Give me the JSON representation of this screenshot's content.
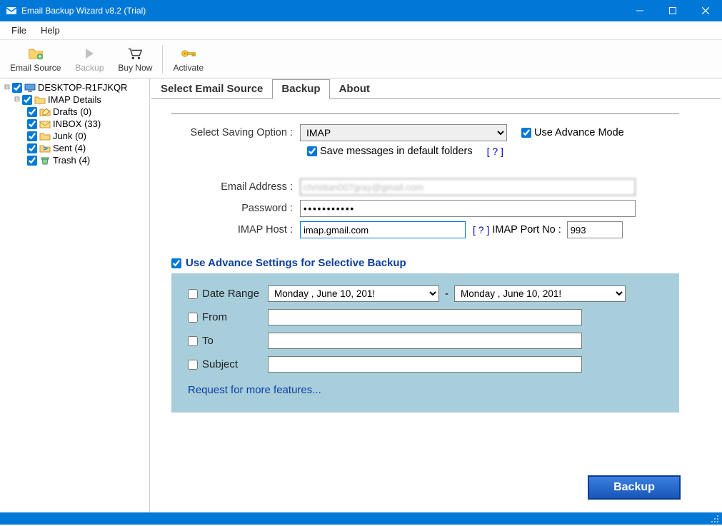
{
  "window": {
    "title": "Email Backup Wizard v8.2 (Trial)"
  },
  "menu": {
    "file": "File",
    "help": "Help"
  },
  "toolbar": {
    "email_source": "Email Source",
    "backup": "Backup",
    "buy_now": "Buy Now",
    "activate": "Activate"
  },
  "tree": {
    "root": "DESKTOP-R1FJKQR",
    "imap": "IMAP Details",
    "folders": [
      "Drafts (0)",
      "INBOX (33)",
      "Junk (0)",
      "Sent (4)",
      "Trash (4)"
    ]
  },
  "tabs": {
    "select_source": "Select Email Source",
    "backup": "Backup",
    "about": "About"
  },
  "form": {
    "saving_option_label": "Select Saving Option  :",
    "saving_option_value": "IMAP",
    "use_advance_mode": "Use Advance Mode",
    "save_default": "Save messages in default folders",
    "help": "[ ? ]",
    "email_label": "Email Address  :",
    "email_value": "christian007gray@gmail.com",
    "password_label": "Password  :",
    "password_value": "•••••••••••",
    "imap_host_label": "IMAP Host  :",
    "imap_host_value": "imap.gmail.com",
    "imap_port_label": "IMAP Port No  :",
    "imap_port_value": "993"
  },
  "adv": {
    "title": "Use Advance Settings for Selective Backup",
    "date_range": "Date Range",
    "date_from": "Monday    ,       June      10, 201!",
    "date_to": "Monday    ,       June      10, 201!",
    "from": "From",
    "to": "To",
    "subject": "Subject",
    "request": "Request for more features..."
  },
  "buttons": {
    "backup": "Backup"
  }
}
